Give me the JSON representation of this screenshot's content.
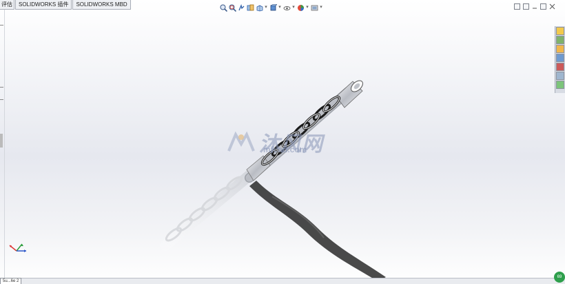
{
  "tabs": [
    {
      "label": "评估"
    },
    {
      "label": "SOLIDWORKS 插件"
    },
    {
      "label": "SOLIDWORKS MBD"
    }
  ],
  "hud_icons": [
    "zoom-to-fit-icon",
    "zoom-to-area-icon",
    "previous-view-icon",
    "section-view-icon",
    "view-orientation-icon",
    "display-style-icon",
    "hide-show-items-icon",
    "edit-appearance-icon",
    "apply-scene-icon",
    "view-settings-icon"
  ],
  "watermark": {
    "text": "沐风网",
    "url": "mfcad.com"
  },
  "sheet_tab": {
    "label": "5u...6e 2"
  },
  "corner_badge": {
    "label": "69"
  },
  "colors": {
    "accent": "#2e9f4c",
    "spring_dark": "#1a1a1a",
    "metal": "#c9ccd2"
  }
}
